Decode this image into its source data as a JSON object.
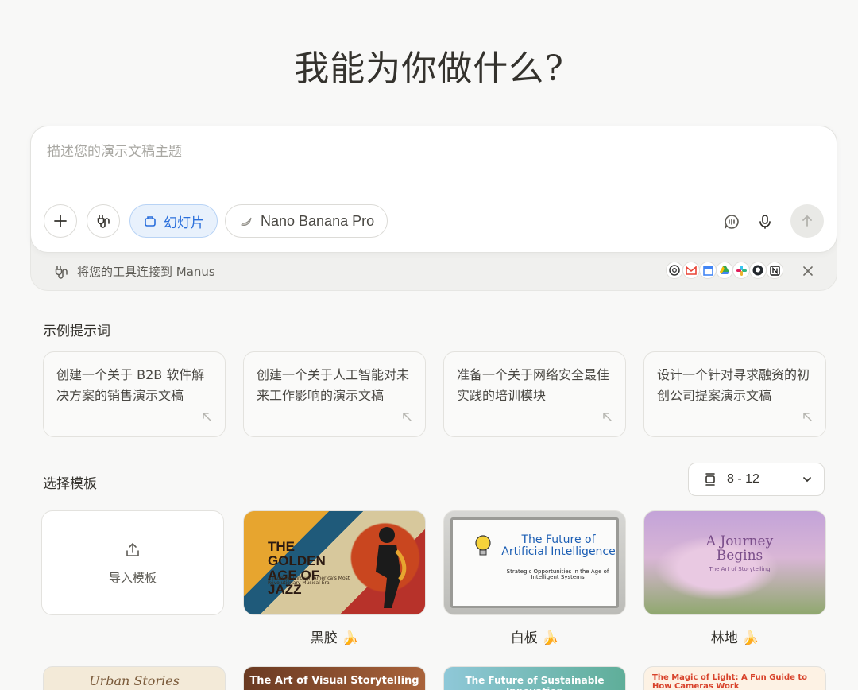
{
  "page": {
    "title": "我能为你做什么?"
  },
  "composer": {
    "placeholder": "描述您的演示文稿主题",
    "mode_label": "幻灯片",
    "model_label": "Nano Banana Pro",
    "connect_text": "将您的工具连接到 Manus",
    "tool_icons": [
      "chrome-icon",
      "gmail-icon",
      "calendar-icon",
      "drive-icon",
      "slack-icon",
      "github-icon",
      "notion-icon"
    ]
  },
  "prompts": {
    "heading": "示例提示词",
    "items": [
      "创建一个关于 B2B 软件解决方案的销售演示文稿",
      "创建一个关于人工智能对未来工作影响的演示文稿",
      "准备一个关于网络安全最佳实践的培训模块",
      "设计一个针对寻求融资的初创公司提案演示文稿"
    ]
  },
  "templates": {
    "heading": "选择模板",
    "slide_count": "8 - 12",
    "import_label": "导入模板",
    "cards": [
      {
        "label": "黑胶 🍌",
        "thumb_title": "THE GOLDEN AGE OF JAZZ",
        "thumb_sub": "A Journey Through America's Most Revolutionary Musical Era"
      },
      {
        "label": "白板 🍌",
        "thumb_title": "The Future of Artificial Intelligence",
        "thumb_sub": "Strategic Opportunities in the Age of Intelligent Systems"
      },
      {
        "label": "林地 🍌",
        "thumb_title": "A Journey Begins",
        "thumb_sub": "The Art of Storytelling"
      }
    ],
    "row2": [
      "Urban Stories",
      "The Art of Visual Storytelling",
      "The Future of Sustainable Innovation",
      "The Magic of Light: A Fun Guide to How Cameras Work"
    ]
  },
  "colors": {
    "accent": "#2a6fdb",
    "background": "#f8f8f7"
  }
}
